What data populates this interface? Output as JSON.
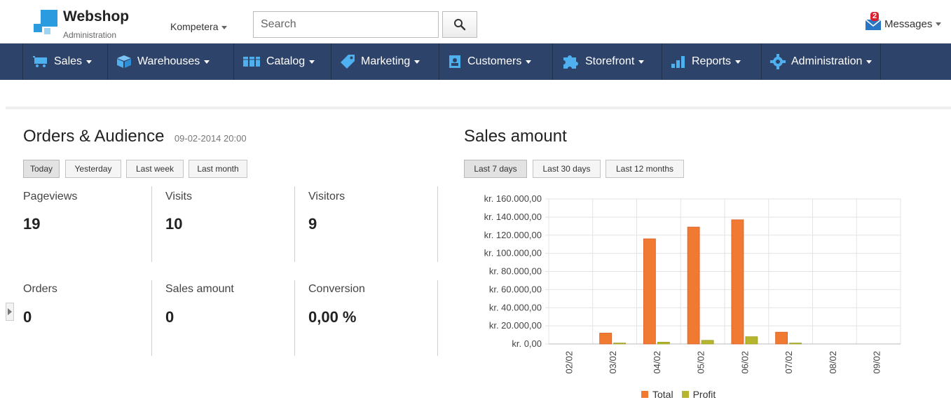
{
  "header": {
    "brand_title": "Webshop",
    "brand_subtitle": "Administration",
    "store_selector": "Kompetera",
    "search_placeholder": "Search",
    "messages_label": "Messages",
    "messages_count": "2"
  },
  "nav": {
    "items": [
      {
        "label": "Sales",
        "icon": "cart-icon"
      },
      {
        "label": "Warehouses",
        "icon": "box-icon"
      },
      {
        "label": "Catalog",
        "icon": "catalog-icon"
      },
      {
        "label": "Marketing",
        "icon": "tag-icon"
      },
      {
        "label": "Customers",
        "icon": "contacts-icon"
      },
      {
        "label": "Storefront",
        "icon": "puzzle-icon"
      },
      {
        "label": "Reports",
        "icon": "bar-chart-icon"
      },
      {
        "label": "Administration",
        "icon": "gear-icon"
      }
    ]
  },
  "orders_audience": {
    "title": "Orders & Audience",
    "timestamp": "09-02-2014 20:00",
    "ranges": [
      "Today",
      "Yesterday",
      "Last week",
      "Last month"
    ],
    "active_range": "Today",
    "stats": [
      {
        "label": "Pageviews",
        "value": "19"
      },
      {
        "label": "Visits",
        "value": "10"
      },
      {
        "label": "Visitors",
        "value": "9"
      },
      {
        "label": "Orders",
        "value": "0"
      },
      {
        "label": "Sales amount",
        "value": "0"
      },
      {
        "label": "Conversion",
        "value": "0,00 %"
      }
    ]
  },
  "sales_amount": {
    "title": "Sales amount",
    "ranges": [
      "Last 7 days",
      "Last 30 days",
      "Last 12 months"
    ],
    "active_range": "Last 7 days"
  },
  "chart_data": {
    "type": "bar",
    "title": "",
    "categories": [
      "02/02",
      "03/02",
      "04/02",
      "05/02",
      "06/02",
      "07/02",
      "08/02",
      "09/02"
    ],
    "series": [
      {
        "name": "Total",
        "color": "#f07a32",
        "values": [
          0,
          12000,
          116000,
          129000,
          137000,
          13000,
          0,
          0
        ]
      },
      {
        "name": "Profit",
        "color": "#b5b62e",
        "values": [
          0,
          1000,
          2000,
          4000,
          8000,
          1000,
          0,
          0
        ]
      }
    ],
    "ylim": [
      0,
      160000
    ],
    "y_ticks": [
      "kr. 0,00",
      "kr. 20.000,00",
      "kr. 40.000,00",
      "kr. 60.000,00",
      "kr. 80.000,00",
      "kr. 100.000,00",
      "kr. 120.000,00",
      "kr. 140.000,00",
      "kr. 160.000,00"
    ],
    "grid": true,
    "legend_placement": "bottom-center"
  }
}
